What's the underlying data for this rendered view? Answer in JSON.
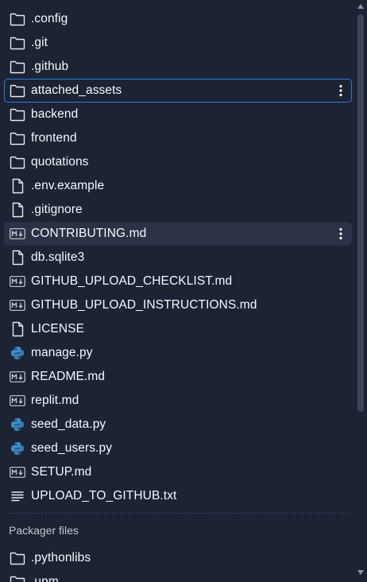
{
  "files": [
    {
      "name": ".config",
      "icon": "folder-icon"
    },
    {
      "name": ".git",
      "icon": "folder-icon"
    },
    {
      "name": ".github",
      "icon": "folder-icon"
    },
    {
      "name": "attached_assets",
      "icon": "folder-icon",
      "state": "selected"
    },
    {
      "name": "backend",
      "icon": "folder-icon"
    },
    {
      "name": "frontend",
      "icon": "folder-icon"
    },
    {
      "name": "quotations",
      "icon": "folder-icon"
    },
    {
      "name": ".env.example",
      "icon": "file-icon"
    },
    {
      "name": ".gitignore",
      "icon": "file-icon"
    },
    {
      "name": "CONTRIBUTING.md",
      "icon": "markdown-icon",
      "state": "hovered"
    },
    {
      "name": "db.sqlite3",
      "icon": "file-icon"
    },
    {
      "name": "GITHUB_UPLOAD_CHECKLIST.md",
      "icon": "markdown-icon"
    },
    {
      "name": "GITHUB_UPLOAD_INSTRUCTIONS.md",
      "icon": "markdown-icon"
    },
    {
      "name": "LICENSE",
      "icon": "file-icon"
    },
    {
      "name": "manage.py",
      "icon": "python-icon"
    },
    {
      "name": "README.md",
      "icon": "markdown-icon"
    },
    {
      "name": "replit.md",
      "icon": "markdown-icon"
    },
    {
      "name": "seed_data.py",
      "icon": "python-icon"
    },
    {
      "name": "seed_users.py",
      "icon": "python-icon"
    },
    {
      "name": "SETUP.md",
      "icon": "markdown-icon"
    },
    {
      "name": "UPLOAD_TO_GITHUB.txt",
      "icon": "text-file-icon"
    }
  ],
  "packager": {
    "title": "Packager files",
    "files": [
      {
        "name": ".pythonlibs",
        "icon": "folder-icon"
      },
      {
        "name": ".upm",
        "icon": "folder-icon"
      }
    ]
  },
  "colors": {
    "background": "#1c2333",
    "text": "#f5f9fc",
    "muted_text": "#c2c8cc",
    "selected_border": "#2f7ad8",
    "hover_background": "#2b3245",
    "python_blue": "#3a8fc9",
    "python_yellow": "#f2c94c"
  }
}
